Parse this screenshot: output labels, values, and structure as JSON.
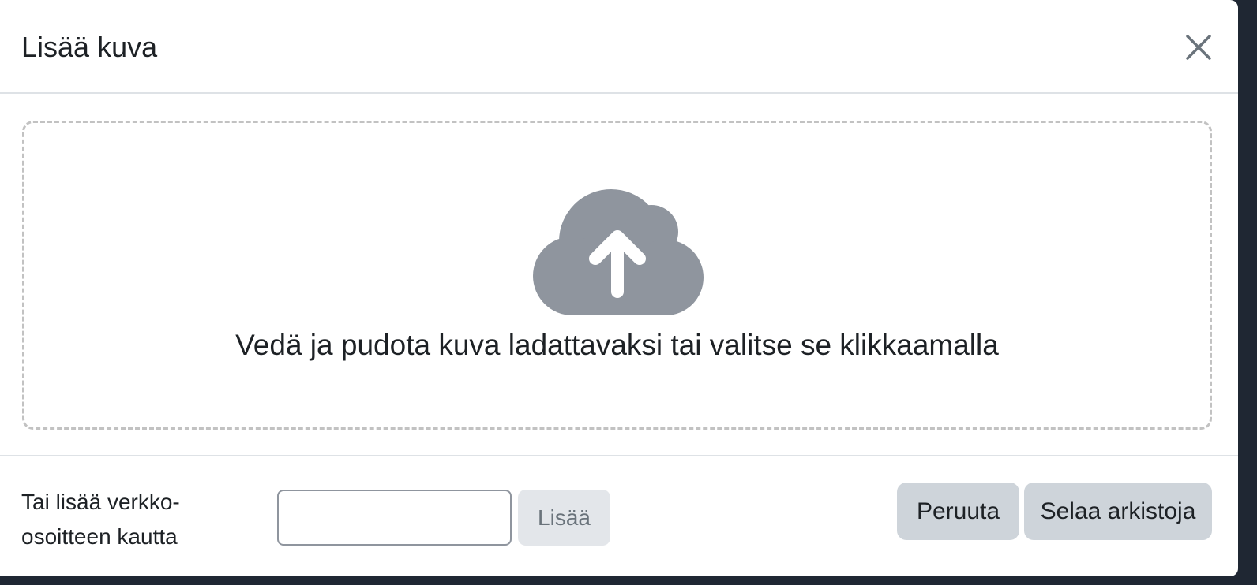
{
  "dialog": {
    "title": "Lisää kuva",
    "close_icon": "close-icon"
  },
  "dropzone": {
    "icon": "cloud-upload-icon",
    "icon_color": "#8f959e",
    "text": "Vedä ja pudota kuva ladattavaksi tai valitse se klikkaamalla"
  },
  "footer": {
    "url_label_line1": "Tai lisää verkko-",
    "url_label_line2": "osoitteen kautta",
    "url_input_value": "",
    "add_label": "Lisää",
    "cancel_label": "Peruuta",
    "browse_label": "Selaa arkistoja"
  },
  "colors": {
    "button_bg": "#ced4da",
    "disabled_button_bg": "#e3e6ea",
    "border": "#dee2e6",
    "dashed_border": "#c2c2c2"
  }
}
